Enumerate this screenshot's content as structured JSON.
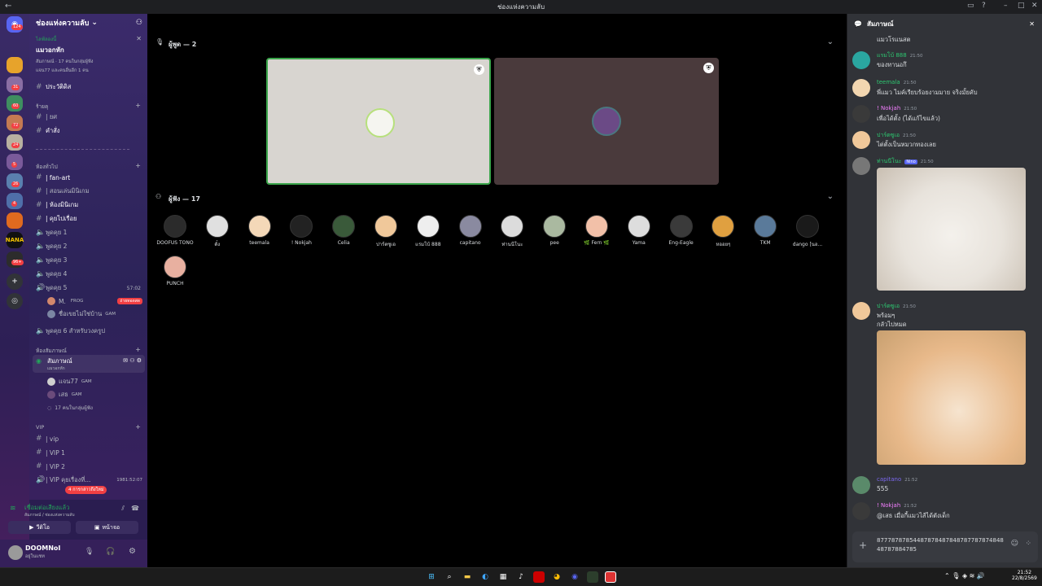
{
  "window": {
    "title": "ช่องแห่งความลับ",
    "back": "←"
  },
  "guild": {
    "name": "ช่องแห่งความลับ",
    "badges": [
      "124",
      "31",
      "60",
      "72",
      "24",
      "5",
      "26",
      "4",
      "96+"
    ]
  },
  "channels": {
    "event_title": "ไลฟ์ลองนี้",
    "event_sub": "แมวอกหัก",
    "event_line1": "สัมภาษณ์ · 17 คนในกลุ่มผู้ฟัง",
    "event_line2": "แจน77 และคนอื่นอีก 1 คน",
    "top": [
      {
        "label": "ประวัติดิส"
      }
    ],
    "cat1": "ร้ายคุ",
    "cat1_items": [
      {
        "label": "| ยศ"
      },
      {
        "label": "คำสั่ง"
      }
    ],
    "cat2": "ห้องทั่วไป",
    "cat2_items": [
      {
        "label": "| fan-art"
      },
      {
        "label": "| สอนเล่นมินิเกม"
      },
      {
        "label": "| ห้องมินิเกม"
      },
      {
        "label": "| คุยไปเรื่อย"
      },
      {
        "label": "พูดคุย 1"
      },
      {
        "label": "พูดคุย 2"
      },
      {
        "label": "พูดคุย 3"
      },
      {
        "label": "พูดคุย 4"
      },
      {
        "label": "พูดคุย 5"
      }
    ],
    "talk5_time": "57:02",
    "talk5_users": [
      {
        "name": "M.",
        "tag": "FROG",
        "badge": "ถ่ายทอดสด"
      },
      {
        "name": "ชื่อเขยไม่ใช่บ้าน",
        "tag": "GAM"
      }
    ],
    "talk6": "พูดคุย 6 สำหรับวงครูป",
    "cat3": "ห้องสัมภาษณ์",
    "stage": {
      "label": "สัมภาษณ์",
      "sub": "แมวอกหัก",
      "users": [
        {
          "name": "แจน77",
          "tag": "GAM"
        },
        {
          "name": "เสธ",
          "tag": "GAM"
        }
      ],
      "listeners": "17 คนในกลุ่มผู้ฟัง"
    },
    "cat4": "VIP",
    "vip_items": [
      {
        "label": "| vip"
      },
      {
        "label": "| VIP 1"
      },
      {
        "label": "| VIP 2"
      },
      {
        "label": "| VIP คุยเรื่องที่..."
      }
    ],
    "vip_time": "1981:52:07",
    "mention": "4 การกล่าวถึงใหม่"
  },
  "voice": {
    "status": "เชื่อมต่อเสียงแล้ว",
    "where": "สัมภาษณ์ / ช่องแห่งความลับ",
    "video": "วีดิโอ",
    "screen": "หน้าจอ"
  },
  "user": {
    "name": "DOOMNoI",
    "status": "อยู่ในแชท"
  },
  "stage": {
    "speakers_label": "ผู้พูด — 2",
    "audience_label": "ผู้ฟัง — 17",
    "audience": [
      "DOOFUS TONO",
      "ตั๋ง",
      "teemala",
      "! Nokjah",
      "Celia",
      "ปาร์ตซูเอ",
      "แรมโบ้ 888",
      "capitano",
      "ท่านนีโนะ",
      "pee",
      "🌿 Fern 🌿",
      "Yama",
      "Eng-Eagle",
      "หออยๆ",
      "TKM",
      "dango [นอ...",
      "PUNCH"
    ]
  },
  "chat": {
    "header": "สัมภาษณ์",
    "top_text": "แมวโรแนสต",
    "messages": [
      {
        "author": "แรมโบ้ 888",
        "time": "21:50",
        "text": "ของทานอกึ",
        "color": "#2dc770"
      },
      {
        "author": "teemala",
        "time": "21:50",
        "text": "พี่แมว ไมค์เรียบร้อยงามมาย จริงมั้ยคับ",
        "color": "#2dc770"
      },
      {
        "author": "! Nokjah",
        "time": "21:50",
        "text": "เพื่อได้ตั้ง (ได้แก้ไขแล้ว)",
        "color": "#f47fff"
      },
      {
        "author": "ปาร์ตซูเอ",
        "time": "21:50",
        "text": "ไต่ตั้งเป็นหมวกทองเลย",
        "color": "#2dc770"
      },
      {
        "author": "ท่านนีโนะ",
        "time": "21:50",
        "text": "",
        "color": "#2dc770",
        "badge": "Nino"
      },
      {
        "author": "ปาร์ตซูเอ",
        "time": "21:50",
        "text": "พร้อมๆ",
        "text2": "กลัวไปหมด",
        "color": "#2dc770"
      },
      {
        "author": "capitano",
        "time": "21:52",
        "text": "555",
        "color": "#7b68ee"
      },
      {
        "author": "! Nokjah",
        "time": "21:52",
        "text": "@เสธ เมื่อกี้แมวไส้ได้ตังเด็ก",
        "color": "#f47fff"
      }
    ],
    "composer": "8777878785448787848784878778787484848787884785"
  },
  "taskbar": {
    "time": "21:52",
    "date": "22/8/2569"
  }
}
